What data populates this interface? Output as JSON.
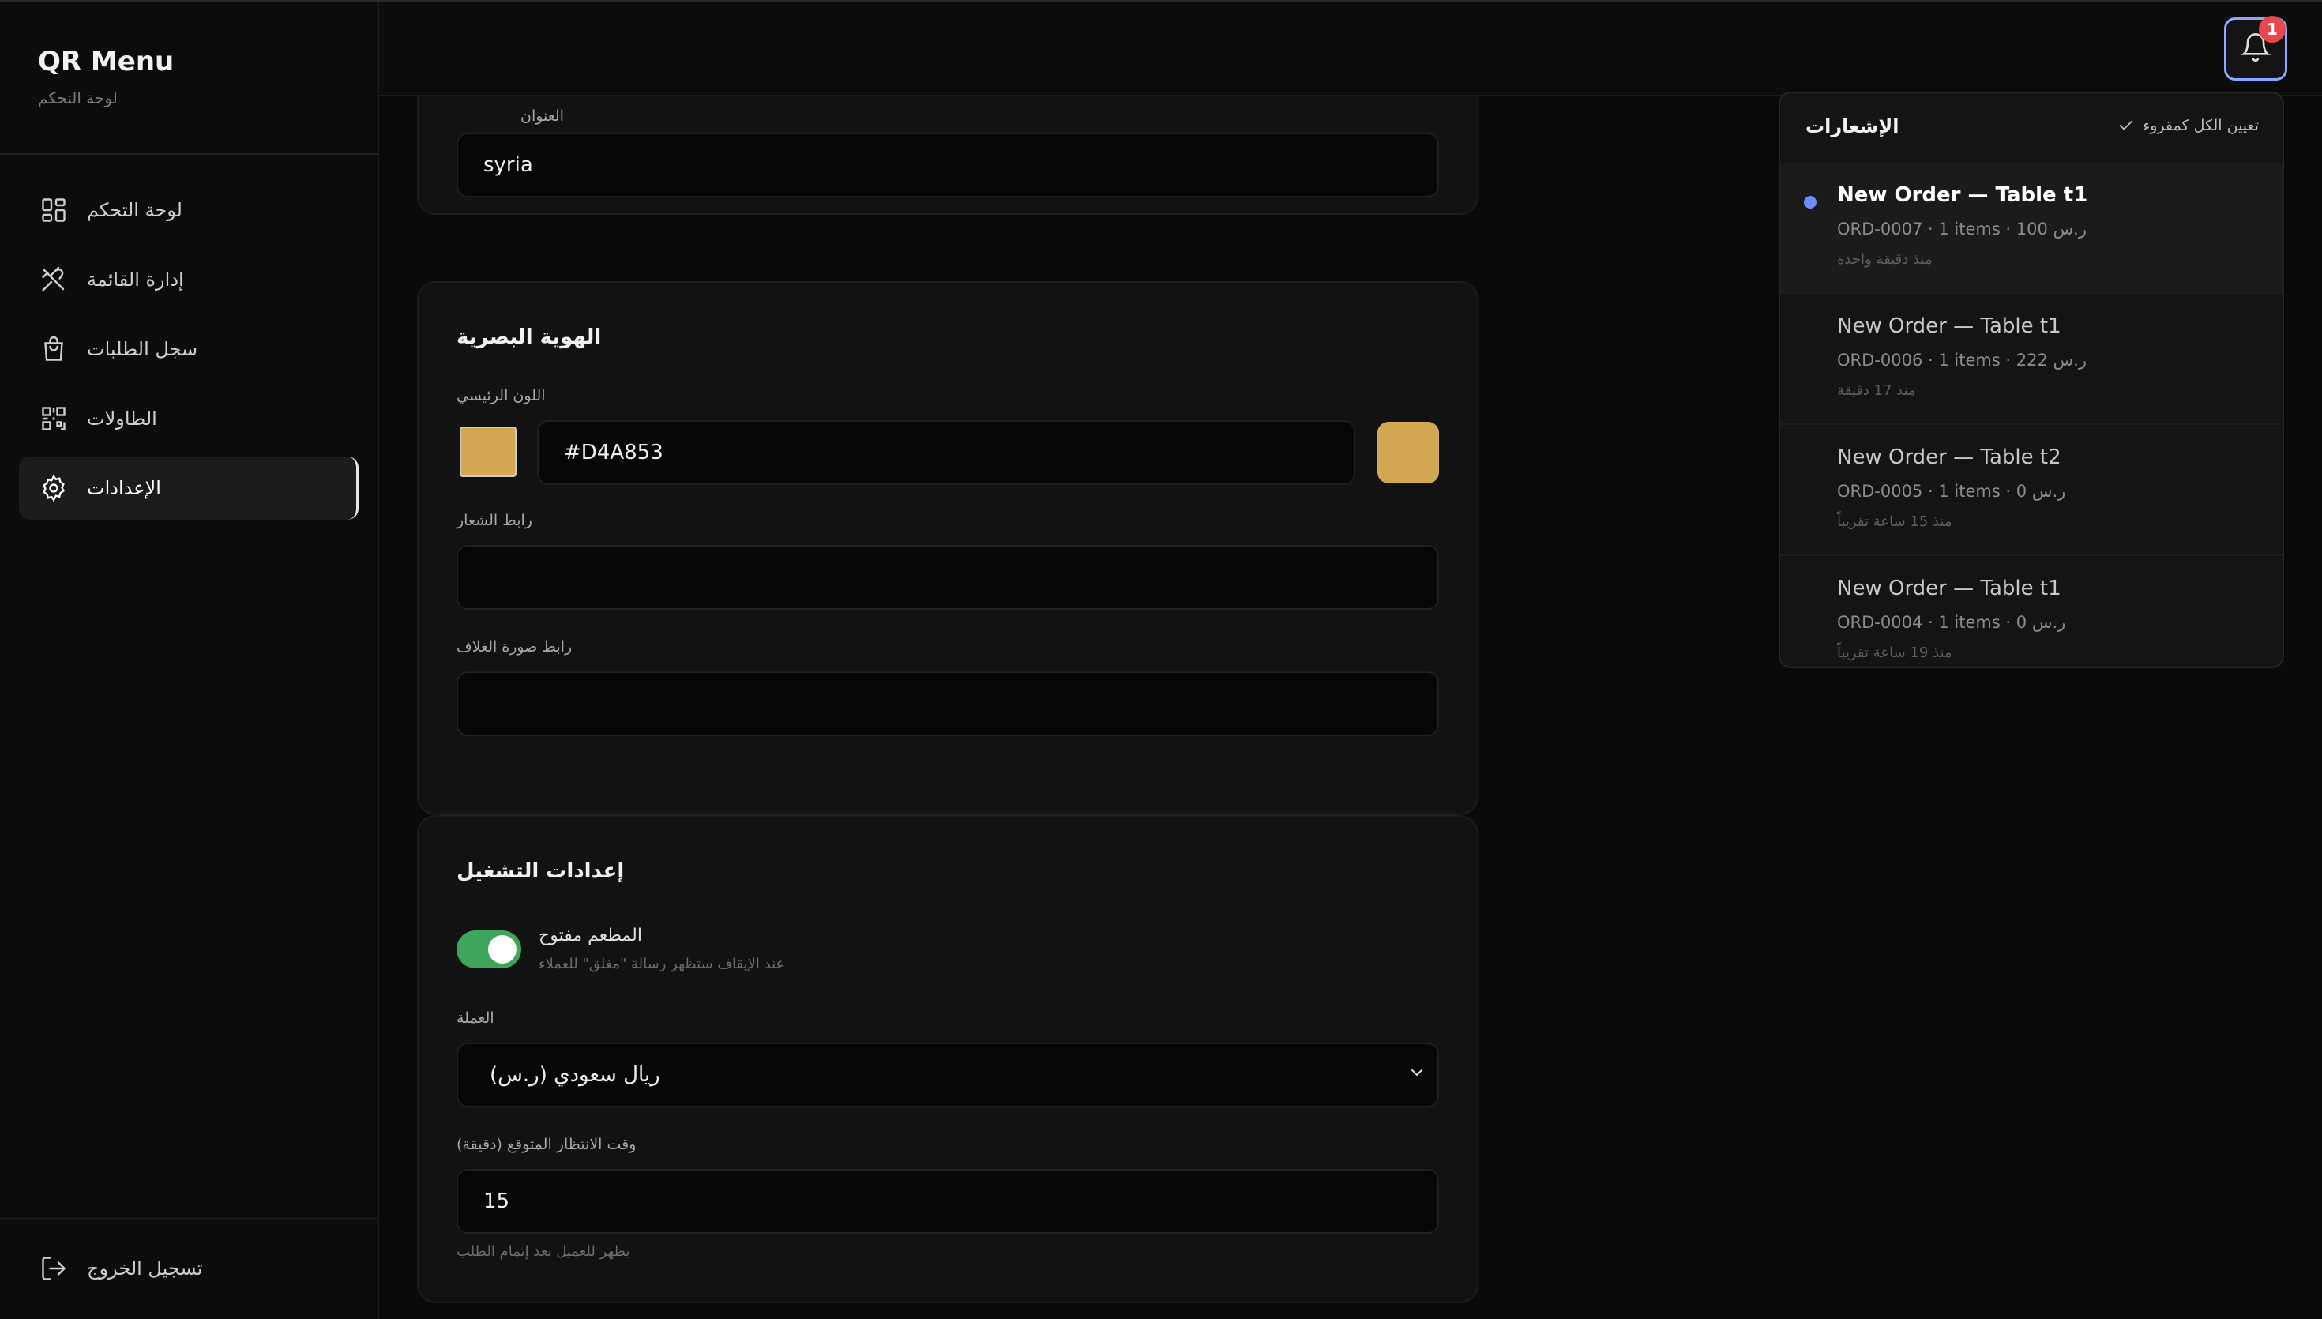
{
  "brand": {
    "title": "QR Menu",
    "subtitle": "لوحة التحكم"
  },
  "sidebar": {
    "items": [
      {
        "label": "لوحة التحكم",
        "icon": "dashboard-grid-icon"
      },
      {
        "label": "إدارة القائمة",
        "icon": "utensils-crossed-icon"
      },
      {
        "label": "سجل الطلبات",
        "icon": "shopping-bag-icon"
      },
      {
        "label": "الطاولات",
        "icon": "qr-code-icon"
      },
      {
        "label": "الإعدادات",
        "icon": "gear-icon",
        "active": true
      }
    ],
    "logout_label": "تسجيل الخروج"
  },
  "header": {
    "notification_count": "1"
  },
  "settings": {
    "address": {
      "label": "العنوان",
      "value": "syria"
    },
    "branding": {
      "title": "الهوية البصرية",
      "primary_color_label": "اللون الرئيسي",
      "primary_color_value": "#D4A853",
      "logo_url_label": "رابط الشعار",
      "logo_url_value": "",
      "cover_url_label": "رابط صورة الغلاف",
      "cover_url_value": ""
    },
    "operation": {
      "title": "إعدادات التشغيل",
      "open_toggle_label": "المطعم مفتوح",
      "open_toggle_help": "عند الإيقاف ستظهر رسالة \"مغلق\" للعملاء",
      "open_toggle_on": true,
      "currency_label": "العملة",
      "currency_value": "ريال سعودي (ر.س)",
      "wait_time_label": "وقت الانتظار المتوقع (دقيقة)",
      "wait_time_value": "15",
      "wait_time_help": "يظهر للعميل بعد إتمام الطلب"
    }
  },
  "notifications": {
    "title": "الإشعارات",
    "mark_all_label": "تعيين الكل كمقروء",
    "items": [
      {
        "title": "New Order — Table t1",
        "meta": "ORD-0007 · 1 items · 100 ر.س",
        "time": "منذ دقيقة واحدة",
        "unread": true
      },
      {
        "title": "New Order — Table t1",
        "meta": "ORD-0006 · 1 items · 222 ر.س",
        "time": "منذ 17 دقيقة",
        "unread": false
      },
      {
        "title": "New Order — Table t2",
        "meta": "ORD-0005 · 1 items · 0 ر.س",
        "time": "منذ 15 ساعة تقريباً",
        "unread": false
      },
      {
        "title": "New Order — Table t1",
        "meta": "ORD-0004 · 1 items · 0 ر.س",
        "time": "منذ 19 ساعة تقريباً",
        "unread": false
      }
    ]
  },
  "colors": {
    "accent": "#D4A853",
    "toggle_on": "#3ea55a",
    "badge": "#e5484d",
    "unread_dot": "#6b8cff"
  }
}
